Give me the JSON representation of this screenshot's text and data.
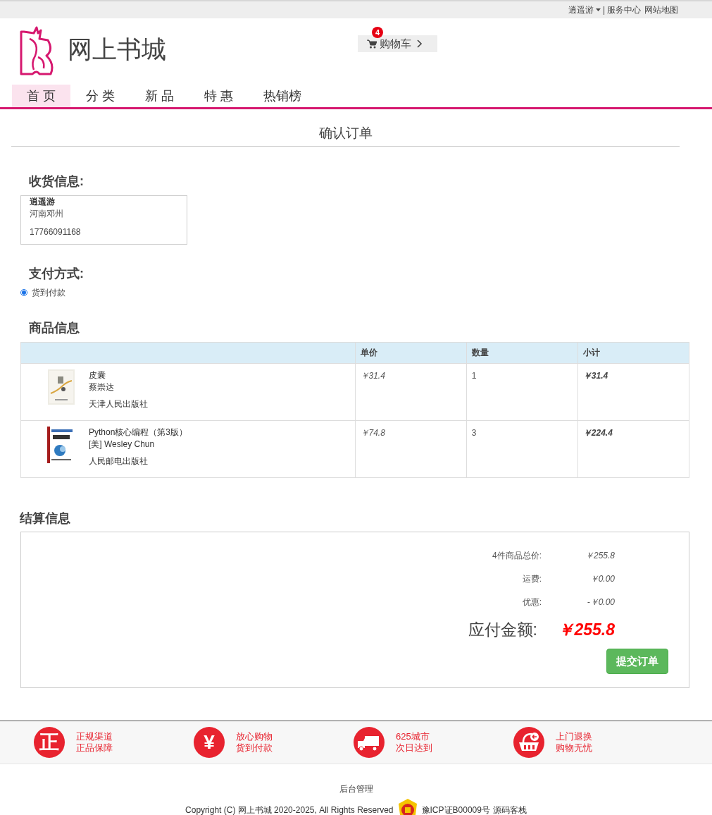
{
  "top_bar": {
    "user_menu": "逍遥游",
    "separator": "|",
    "links": [
      "服务中心",
      "网站地图"
    ]
  },
  "header": {
    "site_title": "网上书城",
    "cart": {
      "label": "购物车",
      "count": "4"
    }
  },
  "nav": [
    {
      "label": "首 页",
      "selected": true
    },
    {
      "label": "分 类",
      "selected": false
    },
    {
      "label": "新 品",
      "selected": false
    },
    {
      "label": "特 惠",
      "selected": false
    },
    {
      "label": "热销榜",
      "selected": false
    }
  ],
  "page_title": "确认订单",
  "shipping": {
    "heading": "收货信息:",
    "name": "逍遥游",
    "address": "河南邓州",
    "phone": "17766091168"
  },
  "payment": {
    "heading": "支付方式:",
    "options": [
      {
        "label": "货到付款",
        "selected": true
      }
    ]
  },
  "products": {
    "heading": "商品信息",
    "columns": [
      "单价",
      "数量",
      "小计"
    ],
    "rows": [
      {
        "title": "皮囊",
        "author": "蔡崇达",
        "publisher": "天津人民出版社",
        "price": "￥31.4",
        "quantity": "1",
        "subtotal": "￥31.4"
      },
      {
        "title": "Python核心编程（第3版）",
        "author": "[美] Wesley Chun",
        "publisher": "人民邮电出版社",
        "price": "￥74.8",
        "quantity": "3",
        "subtotal": "￥224.4"
      }
    ]
  },
  "settlement": {
    "heading": "结算信息",
    "lines": [
      {
        "label": "4件商品总价:",
        "value": "￥255.8"
      },
      {
        "label": "运费:",
        "value": "￥0.00"
      },
      {
        "label": "优惠:",
        "value": "-￥0.00"
      }
    ],
    "total_label": "应付金额:",
    "total_value": "￥255.8",
    "submit": "提交订单"
  },
  "features": [
    {
      "kind": "glyph",
      "glyph": "正",
      "line1": "正规渠道",
      "line2": "正品保障"
    },
    {
      "kind": "glyph",
      "glyph": "¥",
      "line1": "放心购物",
      "line2": "货到付款"
    },
    {
      "kind": "truck",
      "line1": "625城市",
      "line2": "次日达到"
    },
    {
      "kind": "basket",
      "line1": "上门退换",
      "line2": "购物无忧"
    }
  ],
  "footer": {
    "admin_link": "后台管理",
    "copyright": "Copyright (C) 网上书城 2020-2025, All Rights Reserved",
    "icp": "豫ICP证B00009号",
    "source_link": "源码客栈"
  }
}
